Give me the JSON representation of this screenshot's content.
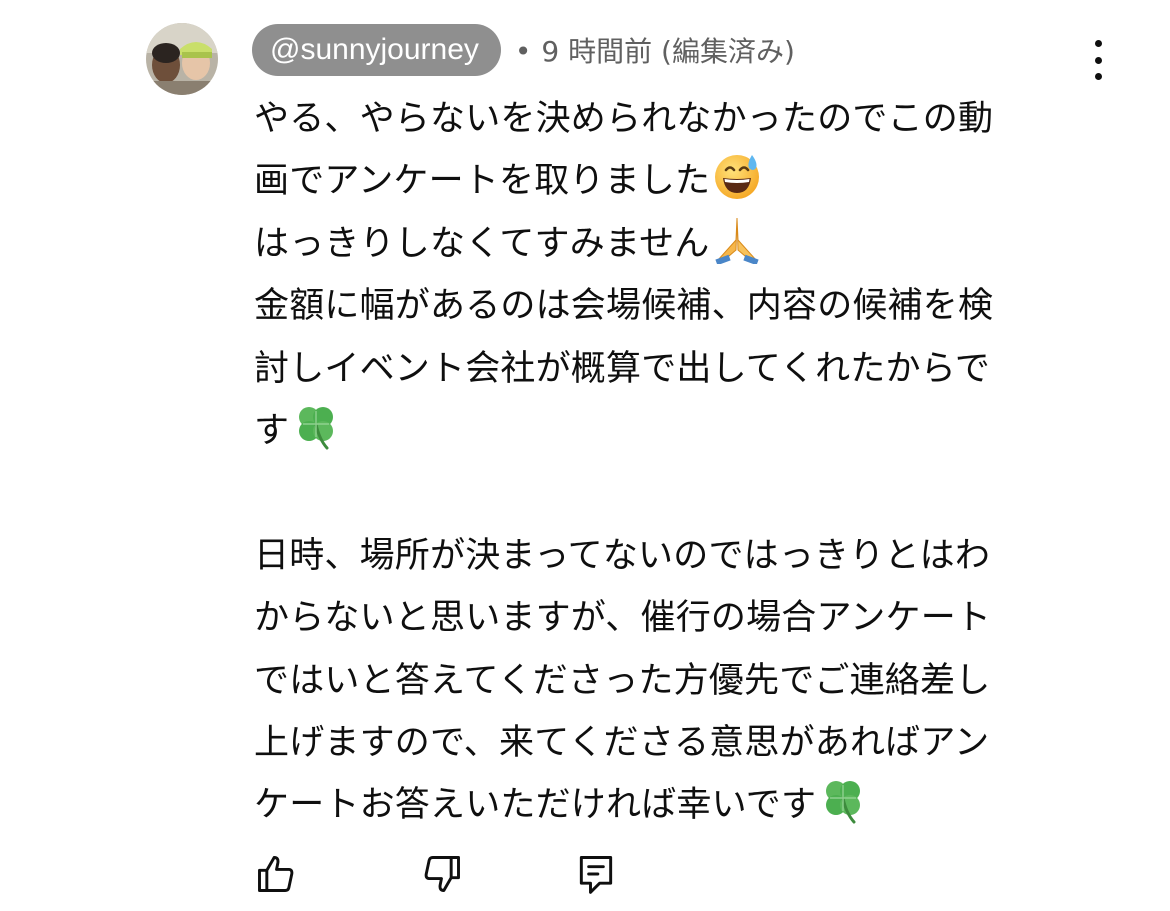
{
  "comment": {
    "author_handle": "@sunnyjourney",
    "separator": "•",
    "time_ago": "9 時間前",
    "edited_label": "(編集済み)",
    "body_lines": [
      "やる、やらないを決められなかったのでこの動",
      "画でアンケートを取りました",
      "はっきりしなくてすみません",
      "金額に幅があるのは会場候補、内容の候補を検",
      "討しイベント会社が概算で出してくれたからで",
      "す",
      "",
      "日時、場所が決まってないのではっきりとはわ",
      "からないと思いますが、催行の場合アンケート",
      "ではいと答えてくださった方優先でご連絡差し",
      "上げますので、来てくださる意思があればアン",
      "ケートお答えいただければ幸いです"
    ],
    "emojis": {
      "line_1": "grinning-sweat-emoji",
      "line_2": "folded-hands-emoji",
      "line_5": "four-leaf-clover-emoji",
      "line_11": "four-leaf-clover-emoji"
    }
  },
  "actions": {
    "like_icon": "thumbs-up-icon",
    "dislike_icon": "thumbs-down-icon",
    "reply_icon": "comment-reply-icon",
    "more_icon": "vertical-ellipsis-icon"
  },
  "colors": {
    "handle_bg": "#8f8f8f",
    "handle_text": "#ffffff",
    "meta_text": "#606060",
    "body_text": "#0f0f0f"
  }
}
